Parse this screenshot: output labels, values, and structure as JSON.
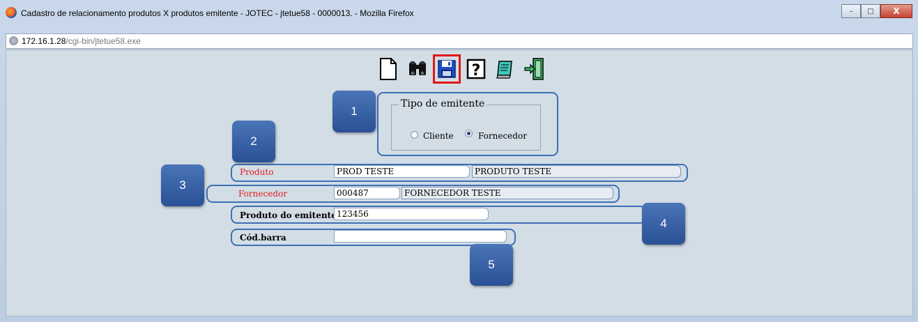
{
  "window": {
    "title": "Cadastro de relacionamento produtos X produtos emitente - JOTEC - jtetue58 - 0000013. - Mozilla Firefox",
    "controls": {
      "minimize": "–",
      "maximize": "□",
      "close": "X"
    }
  },
  "urlbar": {
    "host": "172.16.1.28",
    "path": "/cgi-bin/jtetue58.exe"
  },
  "toolbar": {
    "buttons": [
      {
        "icon": "new-document-icon"
      },
      {
        "icon": "binoculars-icon"
      },
      {
        "icon": "floppy-disk-icon",
        "selected": true
      },
      {
        "icon": "help-icon"
      },
      {
        "icon": "notebook-icon"
      },
      {
        "icon": "exit-door-icon"
      }
    ]
  },
  "badges": [
    "1",
    "2",
    "3",
    "4",
    "5"
  ],
  "tipo_emitente": {
    "legend": "Tipo de emitente",
    "options": [
      {
        "label": "Cliente",
        "selected": false
      },
      {
        "label": "Fornecedor",
        "selected": true
      }
    ]
  },
  "form": {
    "produto": {
      "label": "Produto",
      "code": "PROD TESTE",
      "description": "PRODUTO TESTE"
    },
    "fornecedor": {
      "label": "Fornecedor",
      "code": "000487",
      "description": "FORNECEDOR TESTE"
    },
    "produto_emitente": {
      "label": "Produto do emitente",
      "value": "123456"
    },
    "cod_barra": {
      "label": "Cód.barra",
      "value": ""
    }
  },
  "colors": {
    "badge": "#2a5095",
    "highlight": "#e01717",
    "label_required": "#e02020",
    "border": "#3d6fb6"
  }
}
